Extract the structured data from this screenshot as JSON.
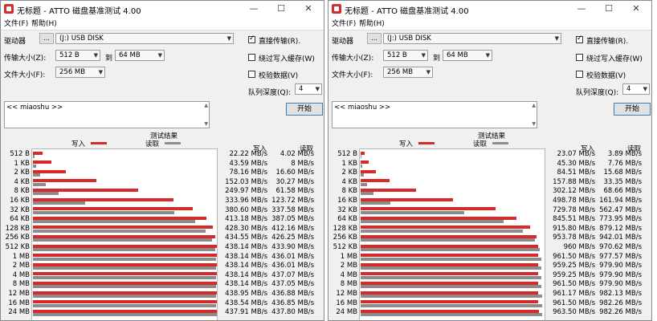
{
  "colors": {
    "write": "#d42a2a",
    "read": "#8c8c8c",
    "accent": "#3c7fb1"
  },
  "windows": [
    {
      "title": "无标题 - ATTO 磁盘基准测试 4.00",
      "menu": [
        "文件(F)",
        "帮助(H)"
      ],
      "drive_label": "驱动器",
      "drive_browse": "...",
      "drive_value": "(J:) USB DISK",
      "transfer_label": "传输大小(Z):",
      "transfer_from": "512 B",
      "transfer_to_label": "到",
      "transfer_to": "64 MB",
      "file_size_label": "文件大小(F):",
      "file_size": "256 MB",
      "direct_io_label": "直接传输(R).",
      "bypass_cache_label": "绕过写入缓存(W)",
      "verify_label": "校验数据(V)",
      "queue_label": "队列深度(Q):",
      "queue_value": "4",
      "notes": "<< miaoshu >>",
      "start_label": "开始",
      "results_title": "测试结果",
      "legend_write": "写入",
      "legend_read": "读取",
      "col_write": "写入",
      "col_read": "读取",
      "rows": [
        {
          "size": "512 B",
          "write": "22.22 MB/s",
          "read": "4.02 MB/s",
          "w": 22.22,
          "r": 4.02
        },
        {
          "size": "1 KB",
          "write": "43.59 MB/s",
          "read": "8 MB/s",
          "w": 43.59,
          "r": 8
        },
        {
          "size": "2 KB",
          "write": "78.16 MB/s",
          "read": "16.60 MB/s",
          "w": 78.16,
          "r": 16.6
        },
        {
          "size": "4 KB",
          "write": "152.03 MB/s",
          "read": "30.27 MB/s",
          "w": 152.03,
          "r": 30.27
        },
        {
          "size": "8 KB",
          "write": "249.97 MB/s",
          "read": "61.58 MB/s",
          "w": 249.97,
          "r": 61.58
        },
        {
          "size": "16 KB",
          "write": "333.96 MB/s",
          "read": "123.72 MB/s",
          "w": 333.96,
          "r": 123.72
        },
        {
          "size": "32 KB",
          "write": "380.60 MB/s",
          "read": "337.58 MB/s",
          "w": 380.6,
          "r": 337.58
        },
        {
          "size": "64 KB",
          "write": "413.18 MB/s",
          "read": "387.05 MB/s",
          "w": 413.18,
          "r": 387.05
        },
        {
          "size": "128 KB",
          "write": "428.30 MB/s",
          "read": "412.16 MB/s",
          "w": 428.3,
          "r": 412.16
        },
        {
          "size": "256 KB",
          "write": "434.55 MB/s",
          "read": "426.25 MB/s",
          "w": 434.55,
          "r": 426.25
        },
        {
          "size": "512 KB",
          "write": "438.14 MB/s",
          "read": "433.90 MB/s",
          "w": 438.14,
          "r": 433.9
        },
        {
          "size": "1 MB",
          "write": "438.14 MB/s",
          "read": "436.01 MB/s",
          "w": 438.14,
          "r": 436.01
        },
        {
          "size": "2 MB",
          "write": "438.14 MB/s",
          "read": "436.01 MB/s",
          "w": 438.14,
          "r": 436.01
        },
        {
          "size": "4 MB",
          "write": "438.14 MB/s",
          "read": "437.07 MB/s",
          "w": 438.14,
          "r": 437.07
        },
        {
          "size": "8 MB",
          "write": "438.14 MB/s",
          "read": "437.05 MB/s",
          "w": 438.14,
          "r": 437.05
        },
        {
          "size": "12 MB",
          "write": "438.95 MB/s",
          "read": "436.88 MB/s",
          "w": 438.95,
          "r": 436.88
        },
        {
          "size": "16 MB",
          "write": "438.54 MB/s",
          "read": "436.85 MB/s",
          "w": 438.54,
          "r": 436.85
        },
        {
          "size": "24 MB",
          "write": "437.91 MB/s",
          "read": "437.80 MB/s",
          "w": 437.91,
          "r": 437.8
        }
      ],
      "max": 440
    },
    {
      "title": "无标题 - ATTO 磁盘基准测试 4.00",
      "menu": [
        "文件(F)",
        "帮助(H)"
      ],
      "drive_label": "驱动器",
      "drive_browse": "...",
      "drive_value": "(J:) USB DISK",
      "transfer_label": "传输大小(Z):",
      "transfer_from": "512 B",
      "transfer_to_label": "到",
      "transfer_to": "64 MB",
      "file_size_label": "文件大小(F):",
      "file_size": "256 MB",
      "direct_io_label": "直接传输(R).",
      "bypass_cache_label": "绕过写入缓存(W)",
      "verify_label": "校验数据(V)",
      "queue_label": "队列深度(Q):",
      "queue_value": "4",
      "notes": "<< miaoshu >>",
      "start_label": "开始",
      "results_title": "测试结果",
      "legend_write": "写入",
      "legend_read": "读取",
      "col_write": "写入",
      "col_read": "读取",
      "rows": [
        {
          "size": "512 B",
          "write": "23.07 MB/s",
          "read": "3.89 MB/s",
          "w": 23.07,
          "r": 3.89
        },
        {
          "size": "1 KB",
          "write": "45.30 MB/s",
          "read": "7.76 MB/s",
          "w": 45.3,
          "r": 7.76
        },
        {
          "size": "2 KB",
          "write": "84.51 MB/s",
          "read": "15.68 MB/s",
          "w": 84.51,
          "r": 15.68
        },
        {
          "size": "4 KB",
          "write": "157.88 MB/s",
          "read": "33.35 MB/s",
          "w": 157.88,
          "r": 33.35
        },
        {
          "size": "8 KB",
          "write": "302.12 MB/s",
          "read": "68.66 MB/s",
          "w": 302.12,
          "r": 68.66
        },
        {
          "size": "16 KB",
          "write": "498.78 MB/s",
          "read": "161.94 MB/s",
          "w": 498.78,
          "r": 161.94
        },
        {
          "size": "32 KB",
          "write": "729.78 MB/s",
          "read": "562.47 MB/s",
          "w": 729.78,
          "r": 562.47
        },
        {
          "size": "64 KB",
          "write": "845.51 MB/s",
          "read": "773.95 MB/s",
          "w": 845.51,
          "r": 773.95
        },
        {
          "size": "128 KB",
          "write": "915.80 MB/s",
          "read": "879.12 MB/s",
          "w": 915.8,
          "r": 879.12
        },
        {
          "size": "256 KB",
          "write": "953.78 MB/s",
          "read": "942.01 MB/s",
          "w": 953.78,
          "r": 942.01
        },
        {
          "size": "512 KB",
          "write": "960 MB/s",
          "read": "970.62 MB/s",
          "w": 960,
          "r": 970.62
        },
        {
          "size": "1 MB",
          "write": "961.50 MB/s",
          "read": "977.57 MB/s",
          "w": 961.5,
          "r": 977.57
        },
        {
          "size": "2 MB",
          "write": "959.25 MB/s",
          "read": "979.90 MB/s",
          "w": 959.25,
          "r": 979.9
        },
        {
          "size": "4 MB",
          "write": "959.25 MB/s",
          "read": "979.90 MB/s",
          "w": 959.25,
          "r": 979.9
        },
        {
          "size": "8 MB",
          "write": "961.50 MB/s",
          "read": "979.90 MB/s",
          "w": 961.5,
          "r": 979.9
        },
        {
          "size": "12 MB",
          "write": "961.17 MB/s",
          "read": "982.13 MB/s",
          "w": 961.17,
          "r": 982.13
        },
        {
          "size": "16 MB",
          "write": "961.50 MB/s",
          "read": "982.26 MB/s",
          "w": 961.5,
          "r": 982.26
        },
        {
          "size": "24 MB",
          "write": "963.50 MB/s",
          "read": "982.26 MB/s",
          "w": 963.5,
          "r": 982.26
        }
      ],
      "max": 1000
    }
  ]
}
